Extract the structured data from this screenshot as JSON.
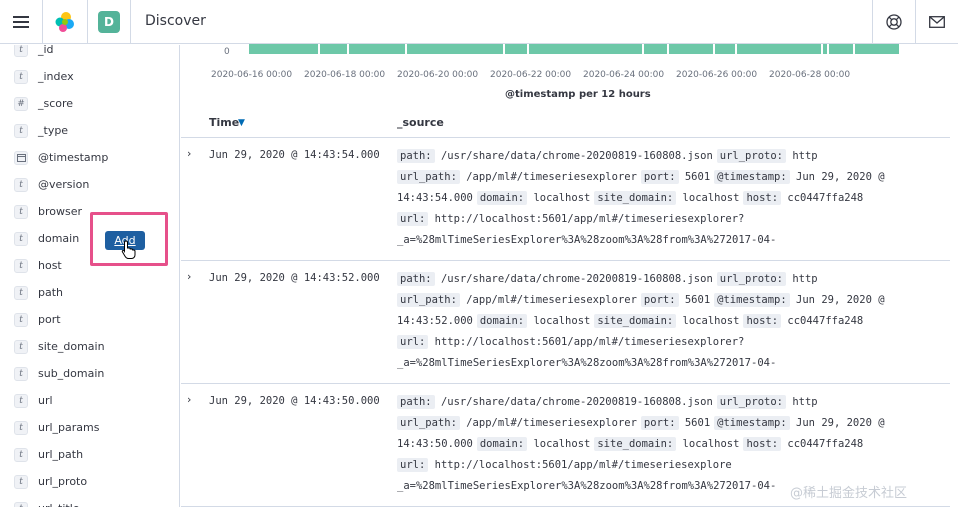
{
  "header": {
    "title": "Discover",
    "space_initial": "D"
  },
  "sidebar": {
    "fields": [
      {
        "name": "_id",
        "type": "t"
      },
      {
        "name": "_index",
        "type": "t"
      },
      {
        "name": "_score",
        "type": "#"
      },
      {
        "name": "_type",
        "type": "t"
      },
      {
        "name": "@timestamp",
        "type": "cal"
      },
      {
        "name": "@version",
        "type": "t"
      },
      {
        "name": "browser",
        "type": "t"
      },
      {
        "name": "domain",
        "type": "t"
      },
      {
        "name": "host",
        "type": "t"
      },
      {
        "name": "path",
        "type": "t"
      },
      {
        "name": "port",
        "type": "t"
      },
      {
        "name": "site_domain",
        "type": "t"
      },
      {
        "name": "sub_domain",
        "type": "t"
      },
      {
        "name": "url",
        "type": "t"
      },
      {
        "name": "url_params",
        "type": "t"
      },
      {
        "name": "url_path",
        "type": "t"
      },
      {
        "name": "url_proto",
        "type": "t"
      },
      {
        "name": "url_title",
        "type": "t"
      }
    ],
    "add_label": "Add"
  },
  "histogram": {
    "zero_label": "0",
    "ticks": [
      "2020-06-16 00:00",
      "2020-06-18 00:00",
      "2020-06-20 00:00",
      "2020-06-22 00:00",
      "2020-06-24 00:00",
      "2020-06-26 00:00",
      "2020-06-28 00:00"
    ],
    "axis_title": "@timestamp per 12 hours",
    "bar_color": "#6dc8a8"
  },
  "table": {
    "col_time": "Time",
    "col_source": "_source"
  },
  "docs": [
    {
      "time": "Jun 29, 2020 @ 14:43:54.000",
      "lines": [
        [
          [
            "path:",
            "/usr/share/data/chrome-20200819-160808.json"
          ],
          [
            "url_proto:",
            "http"
          ]
        ],
        [
          [
            "url_path:",
            "/app/ml#/timeseriesexplorer"
          ],
          [
            "port:",
            "5601"
          ],
          [
            "@timestamp:",
            "Jun 29, 2020 @"
          ]
        ],
        [
          [
            "",
            "14:43:54.000"
          ],
          [
            "domain:",
            "localhost"
          ],
          [
            "site_domain:",
            "localhost"
          ],
          [
            "host:",
            "cc0447ffa248"
          ]
        ],
        [
          [
            "url:",
            "http://localhost:5601/app/ml#/timeseriesexplorer?"
          ]
        ],
        [
          [
            "",
            "_a=%28mlTimeSeriesExplorer%3A%28zoom%3A%28from%3A%272017-04-"
          ]
        ]
      ]
    },
    {
      "time": "Jun 29, 2020 @ 14:43:52.000",
      "lines": [
        [
          [
            "path:",
            "/usr/share/data/chrome-20200819-160808.json"
          ],
          [
            "url_proto:",
            "http"
          ]
        ],
        [
          [
            "url_path:",
            "/app/ml#/timeseriesexplorer"
          ],
          [
            "port:",
            "5601"
          ],
          [
            "@timestamp:",
            "Jun 29, 2020 @"
          ]
        ],
        [
          [
            "",
            "14:43:52.000"
          ],
          [
            "domain:",
            "localhost"
          ],
          [
            "site_domain:",
            "localhost"
          ],
          [
            "host:",
            "cc0447ffa248"
          ]
        ],
        [
          [
            "url:",
            "http://localhost:5601/app/ml#/timeseriesexplorer?"
          ]
        ],
        [
          [
            "",
            "_a=%28mlTimeSeriesExplorer%3A%28zoom%3A%28from%3A%272017-04-"
          ]
        ]
      ]
    },
    {
      "time": "Jun 29, 2020 @ 14:43:50.000",
      "lines": [
        [
          [
            "path:",
            "/usr/share/data/chrome-20200819-160808.json"
          ],
          [
            "url_proto:",
            "http"
          ]
        ],
        [
          [
            "url_path:",
            "/app/ml#/timeseriesexplorer"
          ],
          [
            "port:",
            "5601"
          ],
          [
            "@timestamp:",
            "Jun 29, 2020 @"
          ]
        ],
        [
          [
            "",
            "14:43:50.000"
          ],
          [
            "domain:",
            "localhost"
          ],
          [
            "site_domain:",
            "localhost"
          ],
          [
            "host:",
            "cc0447ffa248"
          ]
        ],
        [
          [
            "url:",
            "http://localhost:5601/app/ml#/timeseriesexplore"
          ]
        ],
        [
          [
            "",
            "_a=%28mlTimeSeriesExplorer%3A%28zoom%3A%28from%3A%272017-04-"
          ]
        ]
      ]
    }
  ],
  "watermark": "@稀土掘金技术社区"
}
